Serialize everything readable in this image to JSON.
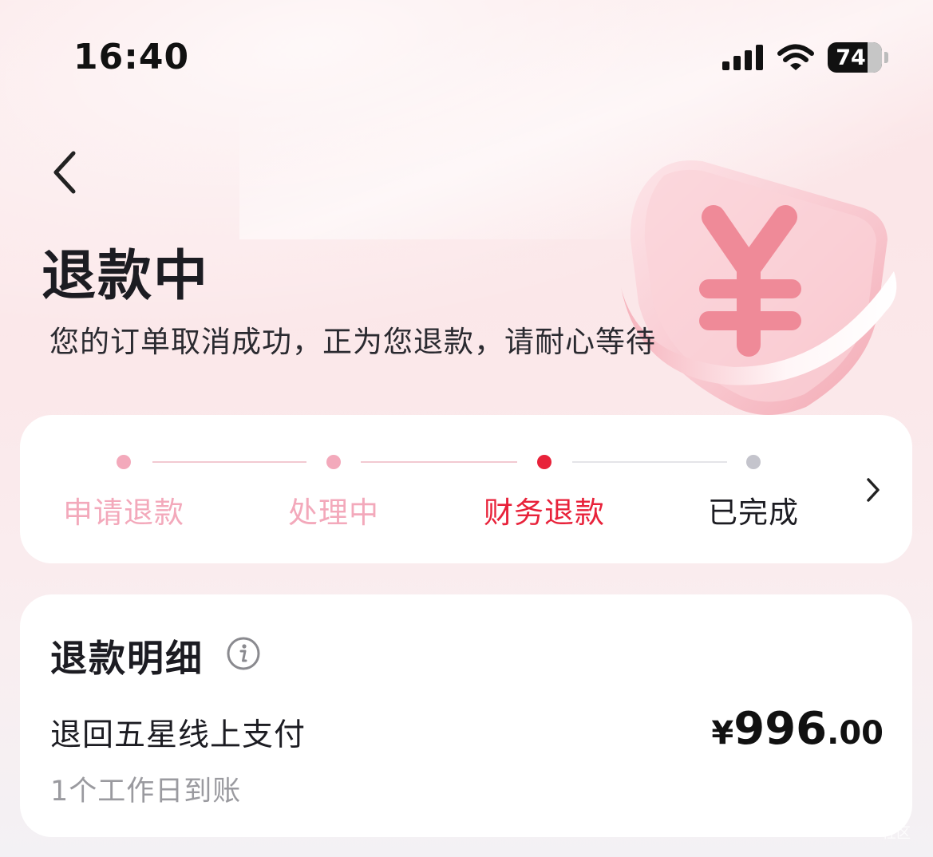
{
  "status_bar": {
    "time": "16:40",
    "battery_level": "74"
  },
  "header": {
    "title": "退款中",
    "subtitle": "您的订单取消成功，正为您退款，请耐心等待"
  },
  "progress": {
    "steps": [
      {
        "label": "申请退款",
        "state": "done"
      },
      {
        "label": "处理中",
        "state": "done"
      },
      {
        "label": "财务退款",
        "state": "current"
      },
      {
        "label": "已完成",
        "state": "pending"
      }
    ],
    "colors": {
      "done": "#f3a9bb",
      "current": "#e8223a",
      "pending": "#c4c4cc",
      "line_done": "#f2c9d1",
      "line_pending": "#e4e4e8"
    }
  },
  "refund_detail": {
    "title": "退款明细",
    "method": "退回五星线上支付",
    "eta": "1个工作日到账",
    "amount": {
      "currency": "¥",
      "integer": "996",
      "decimal": ".00"
    }
  },
  "watermark": "社区"
}
